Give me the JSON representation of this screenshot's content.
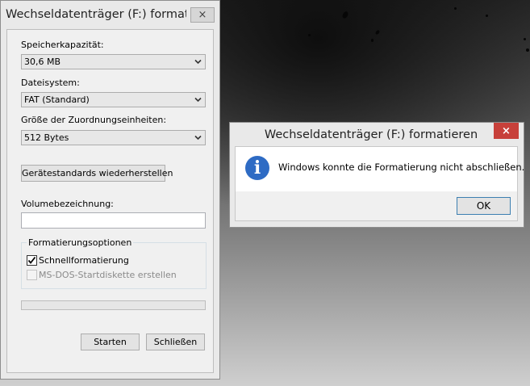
{
  "format_dialog": {
    "title": "Wechseldatenträger (F:) formatieren",
    "capacity_label": "Speicherkapazität:",
    "capacity_value": "30,6 MB",
    "filesystem_label": "Dateisystem:",
    "filesystem_value": "FAT (Standard)",
    "allocation_label": "Größe der Zuordnungseinheiten:",
    "allocation_value": "512 Bytes",
    "restore_defaults_label": "Gerätestandards wiederherstellen",
    "volume_label": "Volumebezeichnung:",
    "volume_value": "",
    "options_group_title": "Formatierungsoptionen",
    "quick_format_label": "Schnellformatierung",
    "quick_format_checked": true,
    "msdos_label": "MS-DOS-Startdiskette erstellen",
    "msdos_checked": false,
    "progress": 0,
    "start_label": "Starten",
    "close_label": "Schließen",
    "close_icon": "×"
  },
  "message_box": {
    "title": "Wechseldatenträger (F:) formatieren",
    "close_icon": "×",
    "icon": "info-icon",
    "icon_glyph": "i",
    "message": "Windows konnte die Formatierung nicht abschließen.",
    "ok_label": "OK",
    "close_color": "#c7403a"
  }
}
